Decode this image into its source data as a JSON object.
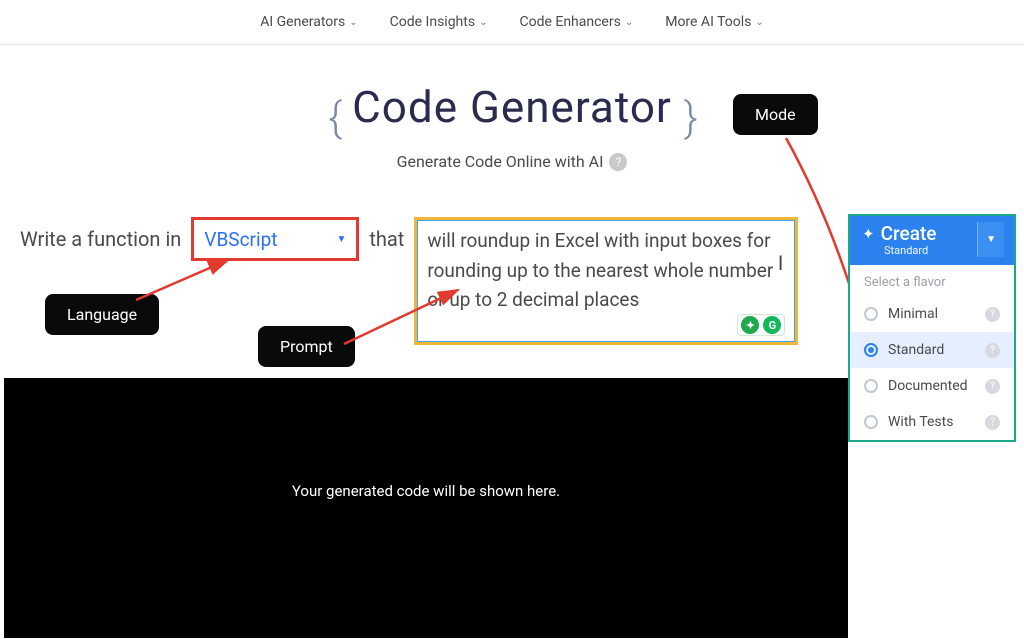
{
  "nav": {
    "items": [
      {
        "label": "AI Generators"
      },
      {
        "label": "Code Insights"
      },
      {
        "label": "Code Enhancers"
      },
      {
        "label": "More AI Tools"
      }
    ]
  },
  "header": {
    "title": "Code Generator",
    "subtitle": "Generate Code Online with AI"
  },
  "input": {
    "prefix": "Write a function in",
    "language": "VBScript",
    "middle": "that",
    "prompt": "will roundup in Excel with input boxes for rounding up to the nearest whole number or up to 2 decimal places"
  },
  "callouts": {
    "language": "Language",
    "prompt": "Prompt",
    "mode": "Mode"
  },
  "create": {
    "label": "Create",
    "sub": "Standard",
    "flavor_title": "Select a flavor",
    "flavors": [
      {
        "label": "Minimal"
      },
      {
        "label": "Standard"
      },
      {
        "label": "Documented"
      },
      {
        "label": "With Tests"
      }
    ]
  },
  "output": {
    "placeholder": "Your generated code will be shown here."
  }
}
